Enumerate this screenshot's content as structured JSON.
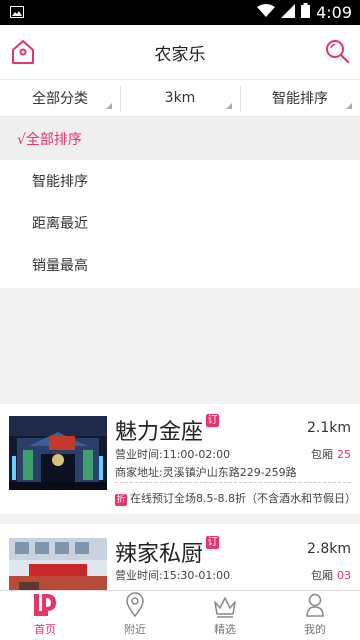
{
  "status_bar": {
    "time": "4:09"
  },
  "header": {
    "title": "农家乐"
  },
  "filters": [
    {
      "label": "全部分类"
    },
    {
      "label": "3km"
    },
    {
      "label": "智能排序"
    }
  ],
  "sort_menu": {
    "options": [
      {
        "label": "√全部排序",
        "selected": true
      },
      {
        "label": "智能排序",
        "selected": false
      },
      {
        "label": "距离最近",
        "selected": false
      },
      {
        "label": "销量最高",
        "selected": false
      }
    ]
  },
  "listings": [
    {
      "name": "魅力金座",
      "badge": "订",
      "distance": "2.1km",
      "hours": "营业时间:11:00-02:00",
      "room_label": "包厢",
      "room_count": "25",
      "address": "商家地址:灵溪镇沪山东路229-259路",
      "promo_badge": "折",
      "promo": "在线预订全场8.5-8.8折（不含酒水和节假日）"
    },
    {
      "name": "辣家私厨",
      "badge": "订",
      "distance": "2.8km",
      "hours": "营业时间:15:30-01:00",
      "room_label": "包厢",
      "room_count": "03"
    }
  ],
  "tabbar": [
    {
      "label": "首页",
      "icon": "home-logo-icon",
      "active": true
    },
    {
      "label": "附近",
      "icon": "location-pin-icon",
      "active": false
    },
    {
      "label": "精选",
      "icon": "crown-icon",
      "active": false
    },
    {
      "label": "我的",
      "icon": "person-icon",
      "active": false
    }
  ],
  "colors": {
    "accent": "#e8336b",
    "background": "#f2f2f2"
  }
}
